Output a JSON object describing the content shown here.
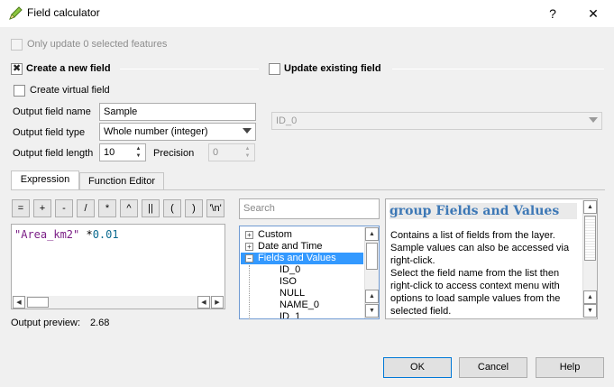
{
  "window": {
    "title": "Field calculator",
    "help_btn": "?",
    "close_btn": "✕"
  },
  "only_update": {
    "label": "Only update 0 selected features",
    "checked": false
  },
  "create_new": {
    "label": "Create a new field",
    "checked": true
  },
  "update_existing": {
    "label": "Update existing field",
    "checked": false,
    "field_value": "ID_0"
  },
  "create_virtual": {
    "label": "Create virtual field",
    "checked": false
  },
  "output_name": {
    "label": "Output field name",
    "value": "Sample"
  },
  "output_type": {
    "label": "Output field type",
    "value": "Whole number (integer)"
  },
  "output_length": {
    "label": "Output field length",
    "value": "10"
  },
  "precision": {
    "label": "Precision",
    "value": "0"
  },
  "tabs": [
    {
      "label": "Expression",
      "active": true
    },
    {
      "label": "Function Editor",
      "active": false
    }
  ],
  "operators": [
    "=",
    "+",
    "-",
    "/",
    "*",
    "^",
    "||",
    "(",
    ")",
    "'\\n'"
  ],
  "expression": {
    "string_part": "\"Area_km2\"",
    "operator_part": " *",
    "number_part": "0.01"
  },
  "output_preview": {
    "label": "Output preview:",
    "value": "2.68"
  },
  "search": {
    "placeholder": "Search"
  },
  "tree": {
    "groups": [
      {
        "label": "Custom",
        "expanded": false
      },
      {
        "label": "Date and Time",
        "expanded": false
      },
      {
        "label": "Fields and Values",
        "expanded": true,
        "selected": true
      }
    ],
    "children": [
      "ID_0",
      "ISO",
      "NULL",
      "NAME_0",
      "ID_1"
    ]
  },
  "help": {
    "title": "group Fields and Values",
    "body": "Contains a list of fields from the layer. Sample values can also be accessed via right-click.\nSelect the field name from the list then right-click to access context menu with options to load sample values from the selected field."
  },
  "buttons": {
    "ok": "OK",
    "cancel": "Cancel",
    "help": "Help"
  },
  "icons": {
    "app": "qgis-pencil-icon",
    "expand": "plus-icon",
    "collapse": "minus-icon"
  }
}
